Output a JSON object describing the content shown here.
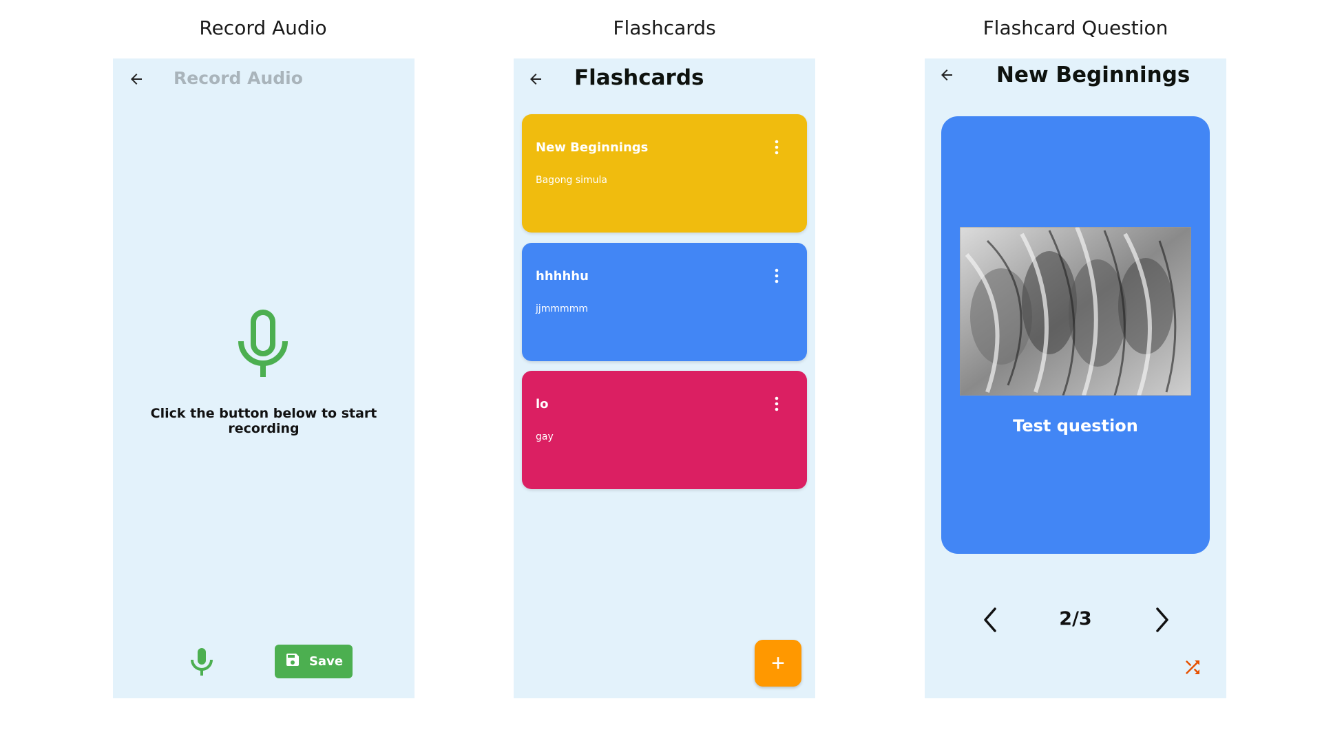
{
  "captions": [
    "Record Audio",
    "Flashcards",
    "Flashcard Question"
  ],
  "record": {
    "title": "Record Audio",
    "prompt": "Click the button below to start recording",
    "save_label": "Save",
    "mic_color": "#4caf50"
  },
  "flashcards": {
    "title": "Flashcards",
    "cards": [
      {
        "title": "New Beginnings",
        "subtitle": "Bagong simula",
        "color": "#f0bc0e"
      },
      {
        "title": "hhhhhu",
        "subtitle": "jjmmmmm",
        "color": "#4286f5"
      },
      {
        "title": "lo",
        "subtitle": "gay",
        "color": "#db1f62"
      }
    ],
    "fab_color": "#ff9800",
    "fab_icon": "plus-icon"
  },
  "question": {
    "title": "New Beginnings",
    "text": "Test question",
    "counter": "2/3",
    "card_color": "#4286f5",
    "shuffle_color": "#e65100"
  }
}
